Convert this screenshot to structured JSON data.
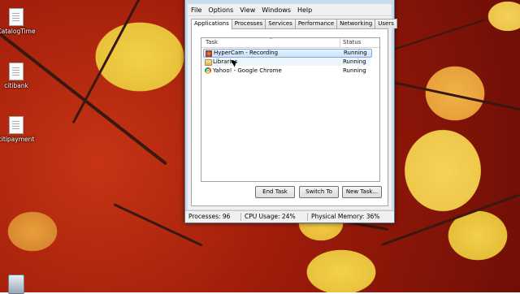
{
  "desktop": {
    "icons": [
      {
        "label": "CatalogTime",
        "icon": "document-icon"
      },
      {
        "label": "citibank",
        "icon": "document-icon"
      },
      {
        "label": "citipayment",
        "icon": "document-icon"
      }
    ],
    "recycle_bin_icon": "recycle-bin-icon"
  },
  "task_manager": {
    "menu": [
      "File",
      "Options",
      "View",
      "Windows",
      "Help"
    ],
    "tabs": [
      {
        "label": "Applications",
        "active": true
      },
      {
        "label": "Processes",
        "active": false
      },
      {
        "label": "Services",
        "active": false
      },
      {
        "label": "Performance",
        "active": false
      },
      {
        "label": "Networking",
        "active": false
      },
      {
        "label": "Users",
        "active": false
      }
    ],
    "list": {
      "columns": {
        "task": "Task",
        "status": "Status"
      },
      "rows": [
        {
          "task": "HyperCam - Recording",
          "status": "Running",
          "icon": "hypercam-icon"
        },
        {
          "task": "Libraries",
          "status": "Running",
          "icon": "folder-icon"
        },
        {
          "task": "Yahoo! - Google Chrome",
          "status": "Running",
          "icon": "chrome-icon"
        }
      ]
    },
    "buttons": {
      "end_task": "End Task",
      "switch_to": "Switch To",
      "new_task": "New Task..."
    },
    "status_bar": {
      "processes": "Processes: 96",
      "cpu": "CPU Usage: 24%",
      "memory": "Physical Memory: 36%"
    }
  }
}
